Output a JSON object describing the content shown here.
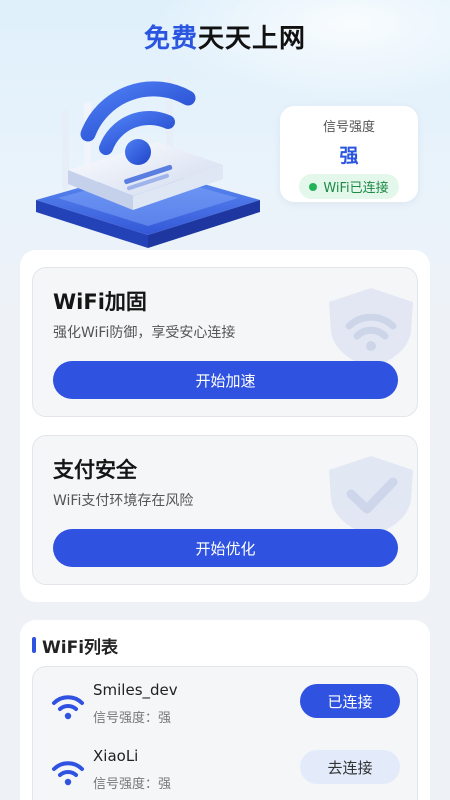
{
  "header": {
    "title_part1": "免费",
    "title_part2": "天天上网"
  },
  "signal_card": {
    "label": "信号强度",
    "value": "强",
    "status": "WiFi已连接"
  },
  "features": [
    {
      "title": "WiFi加固",
      "description": "强化WiFi防御，享受安心连接",
      "button": "开始加速",
      "icon": "shield-wifi-icon"
    },
    {
      "title": "支付安全",
      "description": "WiFi支付环境存在风险",
      "button": "开始优化",
      "icon": "shield-check-icon"
    }
  ],
  "wifi_section": {
    "title": "WiFi列表",
    "networks": [
      {
        "name": "Smiles_dev",
        "strength": "信号强度：强",
        "action": "已连接",
        "state": "connected"
      },
      {
        "name": "XiaoLi",
        "strength": "信号强度：强",
        "action": "去连接",
        "state": "available"
      }
    ]
  },
  "colors": {
    "accent": "#2f53e0",
    "success": "#22b35a",
    "success_bg": "#e3f7ea"
  }
}
